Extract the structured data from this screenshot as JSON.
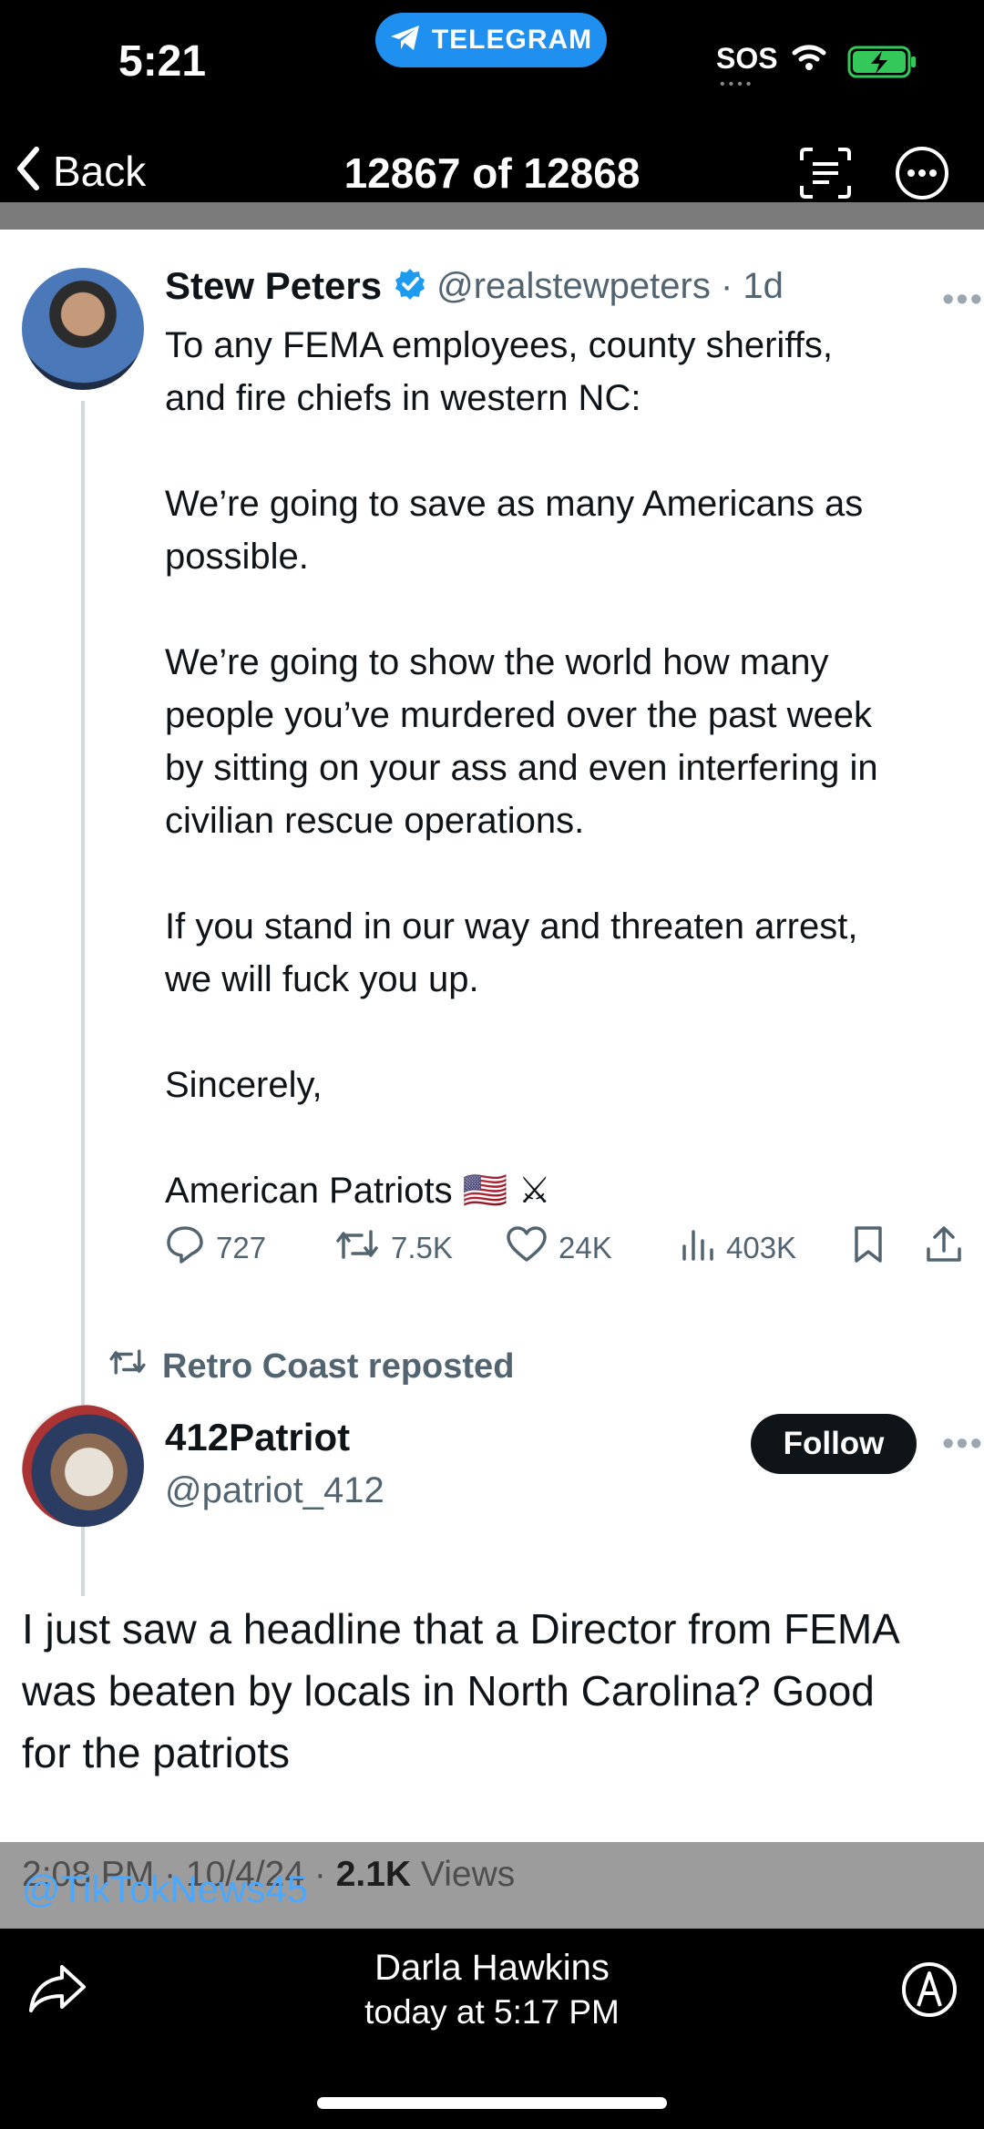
{
  "status_bar": {
    "time": "5:21",
    "app_pill": "TELEGRAM",
    "sos": "SOS",
    "sos_dots": "••••"
  },
  "nav": {
    "back_label": "Back",
    "counter": "12867 of 12868"
  },
  "tweet": {
    "author_name": "Stew Peters",
    "handle_time": "@realstewpeters · 1d",
    "paragraphs": [
      [
        "To any FEMA employees, county sheriffs,",
        "and fire chiefs in western NC:"
      ],
      [
        "We’re going to save as many Americans as",
        "possible."
      ],
      [
        "We’re going to show the world how many",
        "people you’ve murdered over the past week",
        "by sitting on your ass and even interfering in",
        "civilian rescue operations."
      ],
      [
        "If you stand in our way and threaten arrest,",
        "we will fuck you up."
      ],
      [
        "Sincerely,"
      ],
      [
        "American Patriots 🇺🇸 ⚔"
      ]
    ],
    "stats": {
      "replies": "727",
      "reposts": "7.5K",
      "likes": "24K",
      "views": "403K"
    }
  },
  "repost_label": "Retro Coast reposted",
  "tweet2": {
    "author_name": "412Patriot",
    "handle": "@patriot_412",
    "follow_label": "Follow",
    "lines": [
      "I just saw a headline that a Director from FEMA",
      "was beaten by locals in North Carolina? Good",
      "for the patriots"
    ],
    "meta_date": "2:08 PM · 10/4/24 · ",
    "meta_views_count": "2.1K",
    "meta_views_label": " Views"
  },
  "watermark": "@TikTokNews45",
  "footer": {
    "sender": "Darla Hawkins",
    "sent_time": "today at 5:17 PM"
  },
  "colors": {
    "accent_blue": "#1d9bf0",
    "telegram_blue": "#1f8ff0",
    "battery_green": "#34c759",
    "text_primary": "#0f1419",
    "text_secondary": "#536471"
  },
  "icons": [
    "chevron-left-icon",
    "paper-plane-icon",
    "wifi-icon",
    "battery-icon",
    "document-text-icon",
    "ellipsis-circle-icon",
    "verified-badge-icon",
    "reply-icon",
    "repost-icon",
    "like-icon",
    "views-icon",
    "bookmark-icon",
    "share-icon",
    "forward-icon",
    "markup-icon"
  ]
}
